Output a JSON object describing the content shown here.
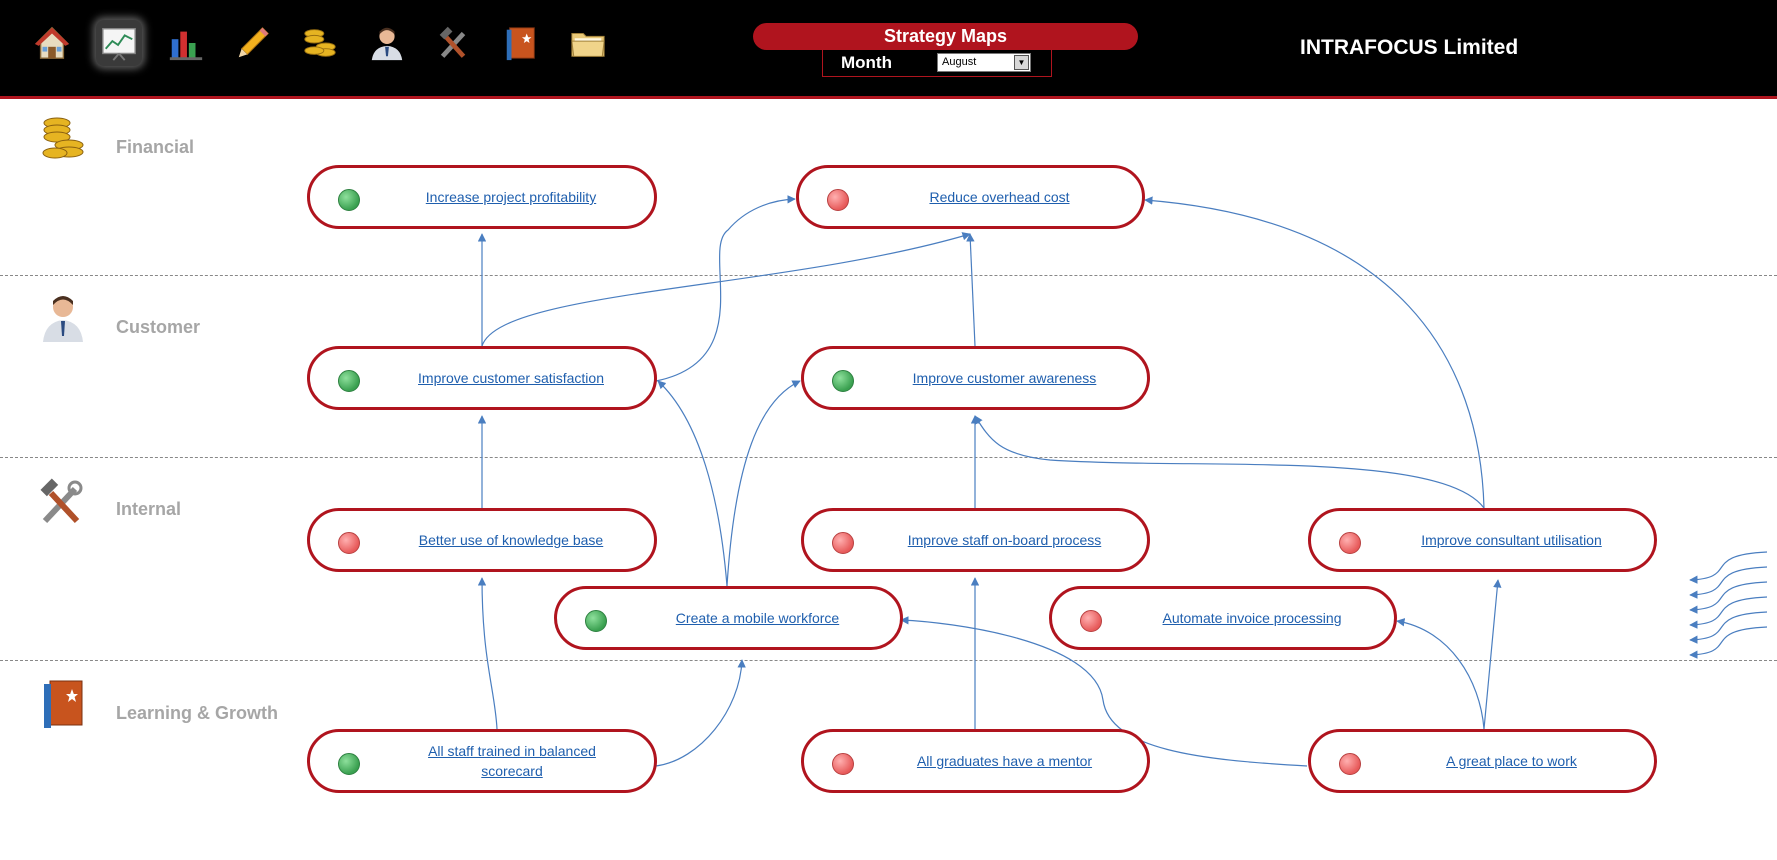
{
  "nav": {
    "items": [
      {
        "name": "home-icon",
        "active": false
      },
      {
        "name": "strategy-map-icon",
        "active": true
      },
      {
        "name": "bar-chart-icon",
        "active": false
      },
      {
        "name": "pencil-icon",
        "active": false
      },
      {
        "name": "coins-icon",
        "active": false
      },
      {
        "name": "person-icon",
        "active": false
      },
      {
        "name": "tools-icon",
        "active": false
      },
      {
        "name": "book-icon",
        "active": false
      },
      {
        "name": "folder-icon",
        "active": false
      }
    ]
  },
  "header": {
    "title": "Strategy Maps",
    "month_label": "Month",
    "month_value": "August",
    "company": "INTRAFOCUS Limited"
  },
  "perspectives": [
    {
      "label": "Financial",
      "icon": "coins-icon"
    },
    {
      "label": "Customer",
      "icon": "person-icon"
    },
    {
      "label": "Internal",
      "icon": "tools-icon"
    },
    {
      "label": "Learning & Growth",
      "icon": "book-icon"
    }
  ],
  "objectives": [
    {
      "label": "Increase project profitability",
      "status": "green"
    },
    {
      "label": "Reduce overhead cost",
      "status": "red"
    },
    {
      "label": "Improve customer satisfaction",
      "status": "green"
    },
    {
      "label": "Improve customer awareness",
      "status": "green"
    },
    {
      "label": "Better use of knowledge base",
      "status": "red"
    },
    {
      "label": "Improve staff on-board process",
      "status": "red"
    },
    {
      "label": "Improve consultant utilisation",
      "status": "red"
    },
    {
      "label": "Create a mobile workforce",
      "status": "green"
    },
    {
      "label": "Automate invoice processing",
      "status": "red"
    },
    {
      "label": "All staff trained in balanced scorecard",
      "status": "green"
    },
    {
      "label": "All graduates have a mentor",
      "status": "red"
    },
    {
      "label": "A great place to work",
      "status": "red"
    }
  ],
  "colors": {
    "brand_red": "#b0141e",
    "link_blue": "#1f5fae",
    "arrow_blue": "#4a7ec0",
    "status_green": "#3aa050",
    "status_red": "#e75a5a"
  }
}
